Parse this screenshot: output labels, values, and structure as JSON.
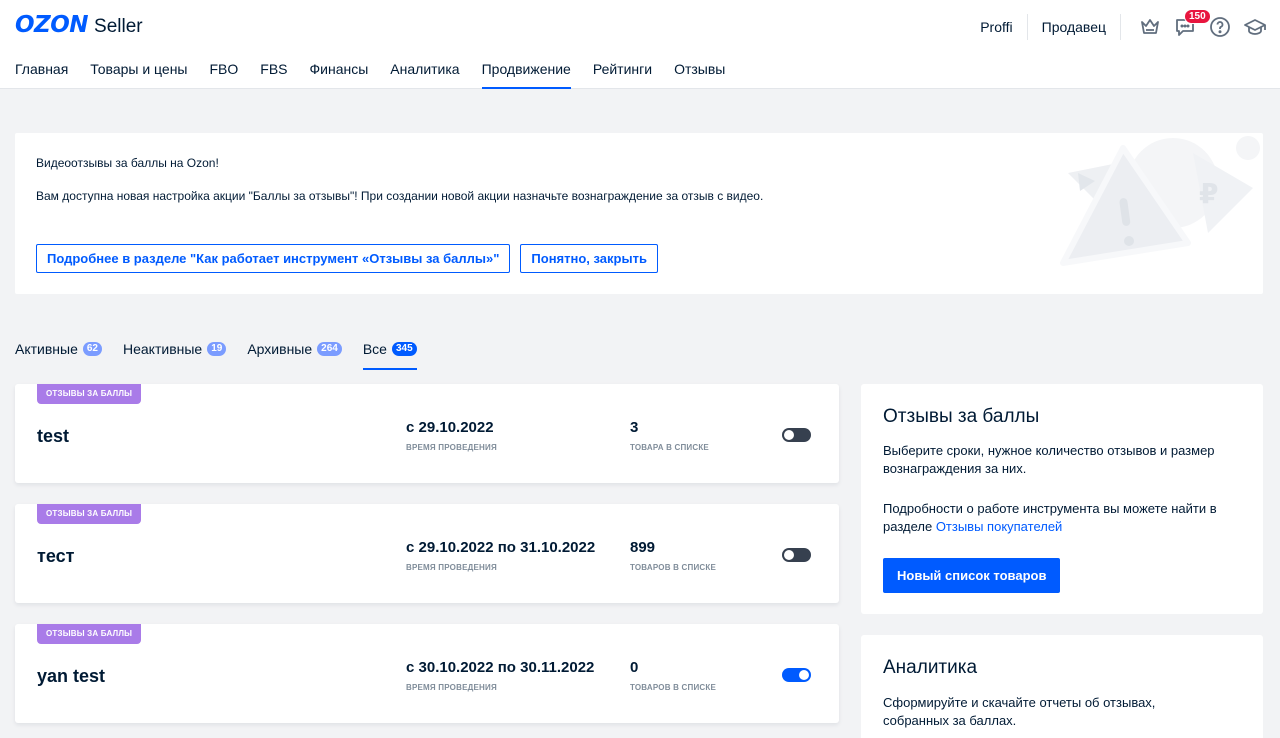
{
  "logo": {
    "brand": "OZON",
    "product": "Seller"
  },
  "top_right": {
    "links": [
      "Proffi",
      "Продавец"
    ],
    "chat_badge": "150"
  },
  "nav": [
    {
      "label": "Главная"
    },
    {
      "label": "Товары и цены"
    },
    {
      "label": "FBO"
    },
    {
      "label": "FBS"
    },
    {
      "label": "Финансы"
    },
    {
      "label": "Аналитика"
    },
    {
      "label": "Продвижение",
      "active": true
    },
    {
      "label": "Рейтинги"
    },
    {
      "label": "Отзывы"
    }
  ],
  "banner": {
    "title": "Видеоотзывы за баллы на Ozon!",
    "text": "Вам доступна новая настройка акции \"Баллы за отзывы\"! При создании новой акции назначьте вознаграждение за отзыв с видео.",
    "more_button": "Подробнее в разделе \"Как работает инструмент «Отзывы за баллы»\"",
    "close_button": "Понятно, закрыть"
  },
  "tabs": [
    {
      "label": "Активные",
      "count": "62"
    },
    {
      "label": "Неактивные",
      "count": "19"
    },
    {
      "label": "Архивные",
      "count": "264"
    },
    {
      "label": "Все",
      "count": "345",
      "active": true
    }
  ],
  "cards": [
    {
      "tag": "ОТЗЫВЫ ЗА БАЛЛЫ",
      "name": "test",
      "date": "с 29.10.2022",
      "date_label": "ВРЕМЯ ПРОВЕДЕНИЯ",
      "count": "3",
      "count_label": "ТОВАРА В СПИСКЕ",
      "enabled": false
    },
    {
      "tag": "ОТЗЫВЫ ЗА БАЛЛЫ",
      "name": "тест",
      "date": "с 29.10.2022 по 31.10.2022",
      "date_label": "ВРЕМЯ ПРОВЕДЕНИЯ",
      "count": "899",
      "count_label": "ТОВАРОВ В СПИСКЕ",
      "enabled": false
    },
    {
      "tag": "ОТЗЫВЫ ЗА БАЛЛЫ",
      "name": "yan test",
      "date": "с 30.10.2022 по 30.11.2022",
      "date_label": "ВРЕМЯ ПРОВЕДЕНИЯ",
      "count": "0",
      "count_label": "ТОВАРОВ В СПИСКЕ",
      "enabled": true
    }
  ],
  "side_reviews": {
    "title": "Отзывы за баллы",
    "text1": "Выберите сроки, нужное количество отзывов и размер вознаграждения за них.",
    "text2_prefix": "Подробности о работе инструмента вы можете найти в разделе ",
    "text2_link": "Отзывы покупателей",
    "button": "Новый список товаров"
  },
  "side_analytics": {
    "title": "Аналитика",
    "text": "Сформируйте и скачайте отчеты об отзывах, собранных за баллах."
  },
  "colors": {
    "accent": "#005bff",
    "tag": "#a97be8",
    "badge": "#e8163f"
  }
}
